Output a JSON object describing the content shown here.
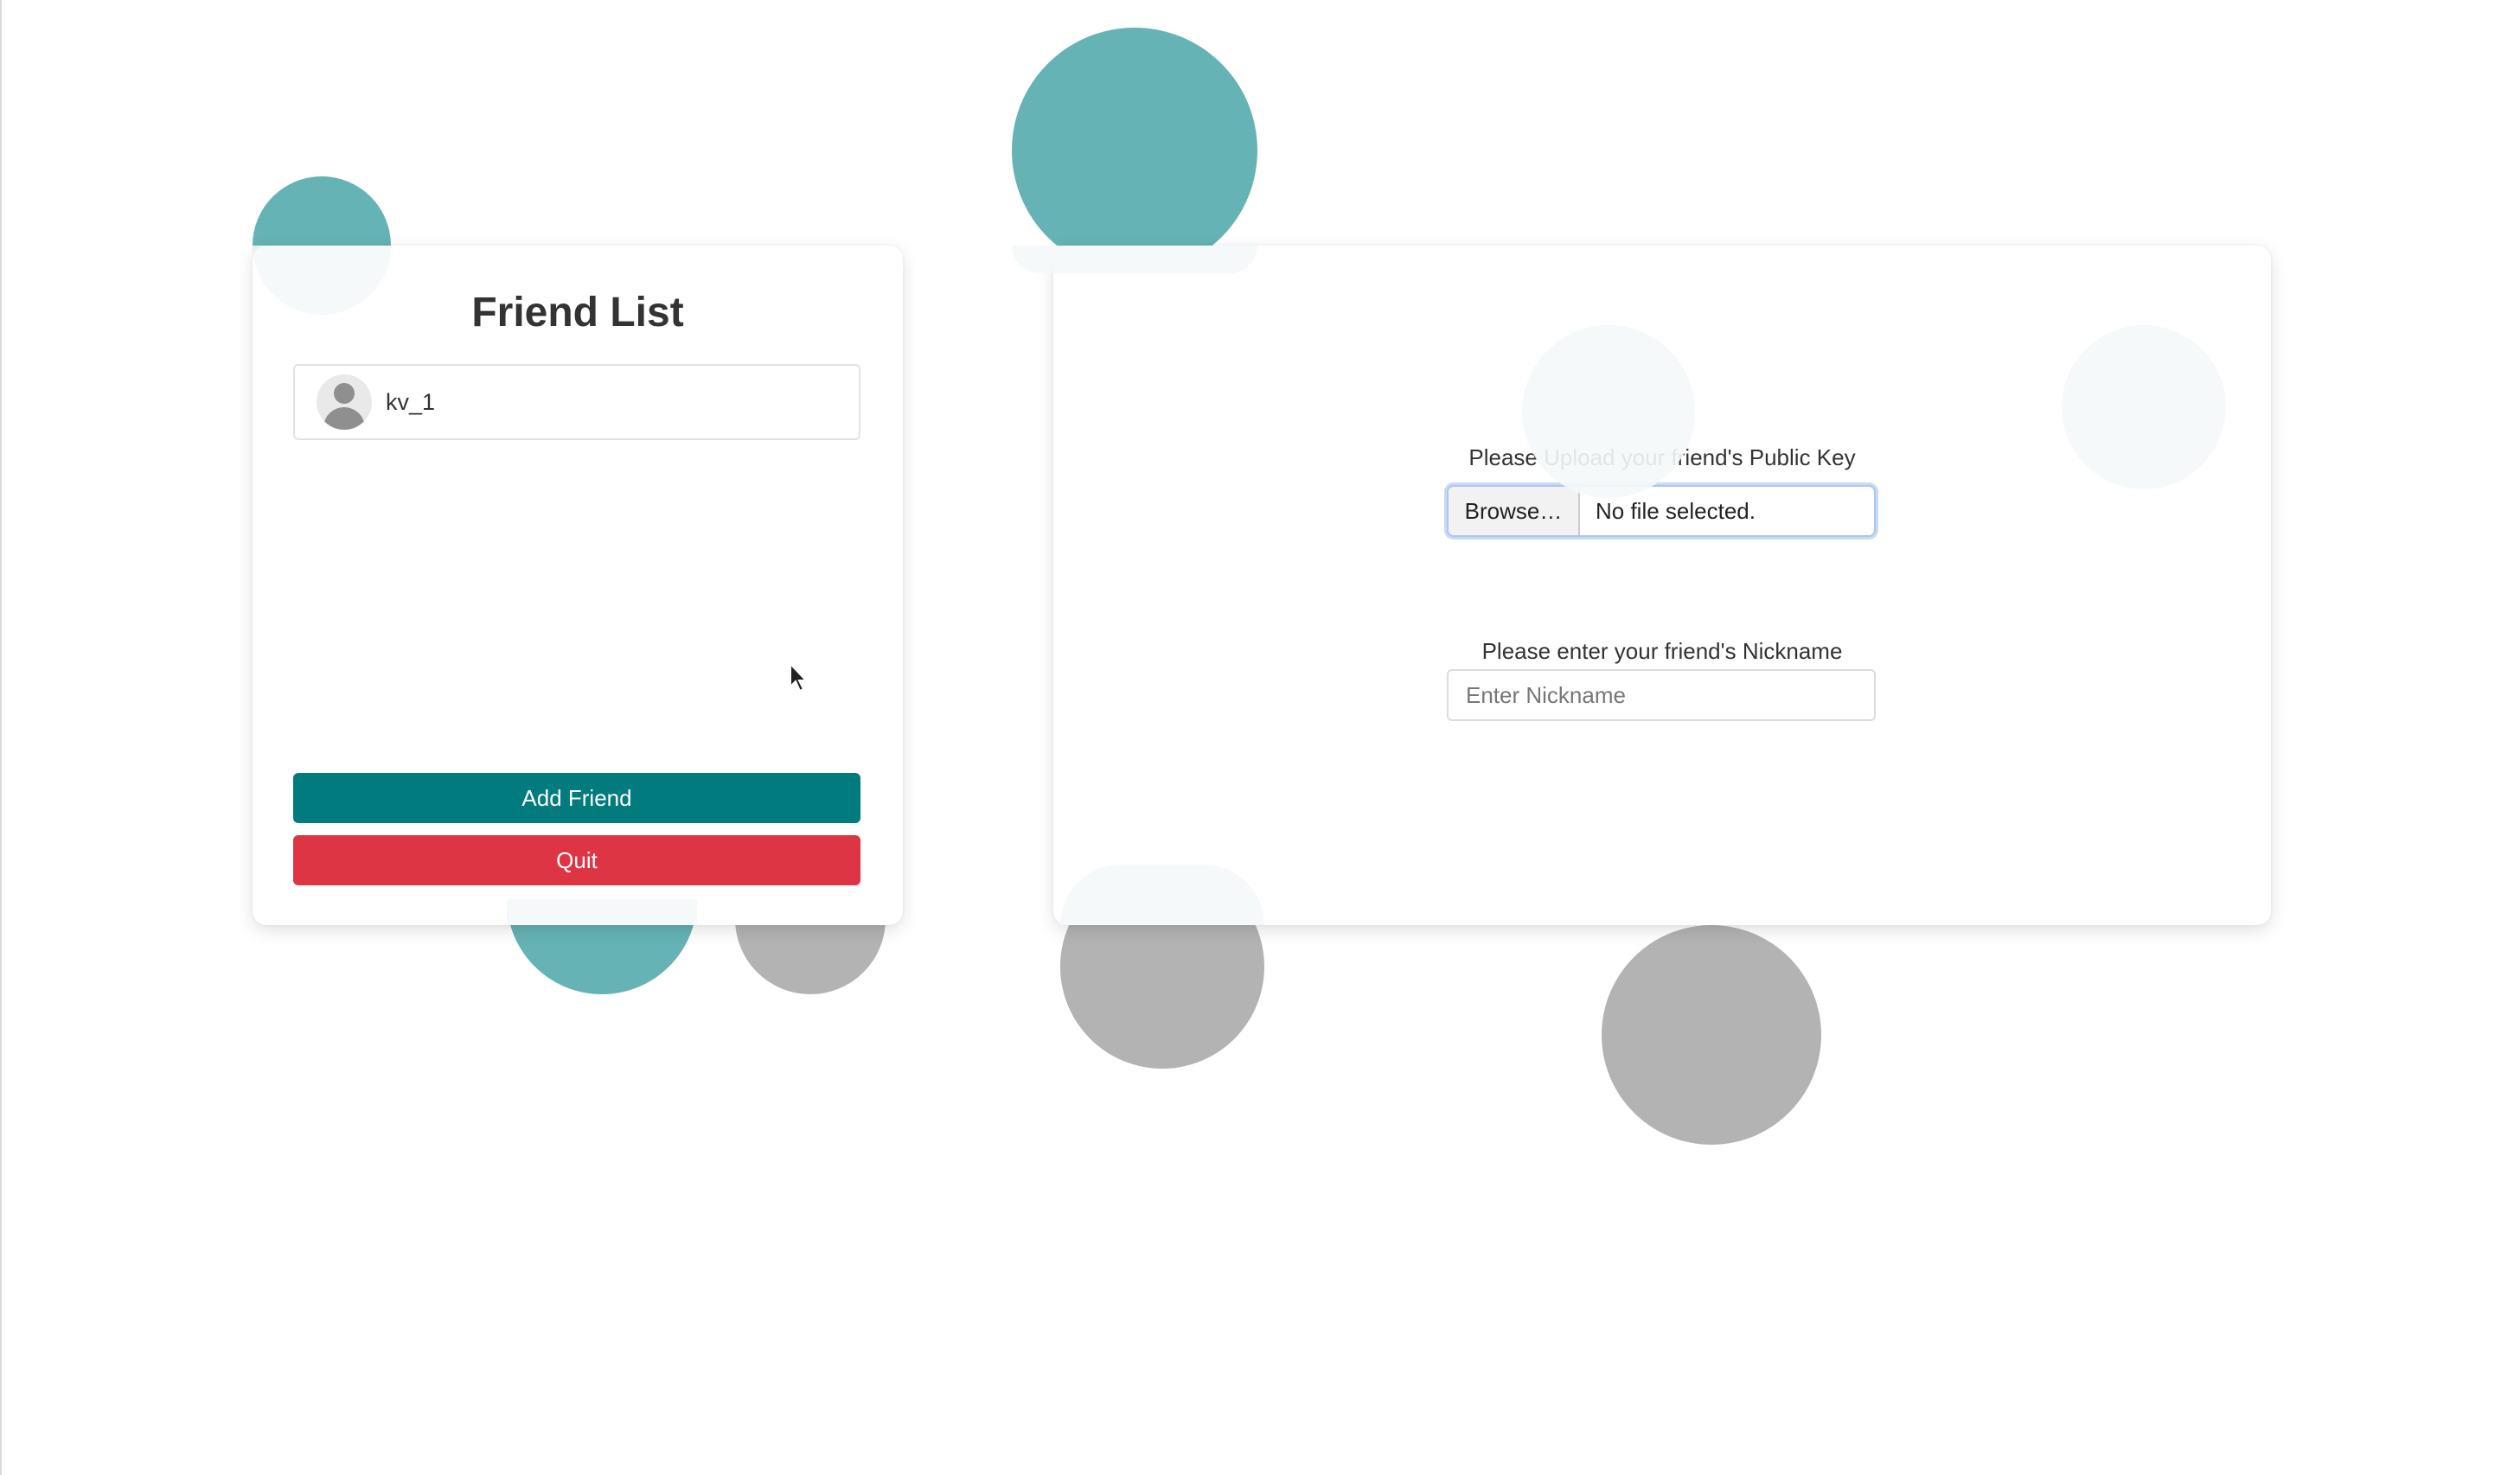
{
  "friend_list": {
    "title": "Friend List",
    "friends": [
      {
        "name": "kv_1"
      }
    ],
    "add_button_label": "Add Friend",
    "quit_button_label": "Quit"
  },
  "add_friend_form": {
    "public_key_label": "Please Upload your friend's Public Key",
    "browse_button_label": "Browse…",
    "file_status": "No file selected.",
    "nickname_label": "Please enter your friend's Nickname",
    "nickname_placeholder": "Enter Nickname",
    "nickname_value": ""
  },
  "colors": {
    "primary_button": "#027b7e",
    "danger_button": "#de3545",
    "bubble_teal": "#65b3b4",
    "bubble_gray": "#b3b3b3"
  },
  "icons": {
    "avatar": "user-avatar-icon",
    "pointer": "mouse-pointer-icon"
  }
}
